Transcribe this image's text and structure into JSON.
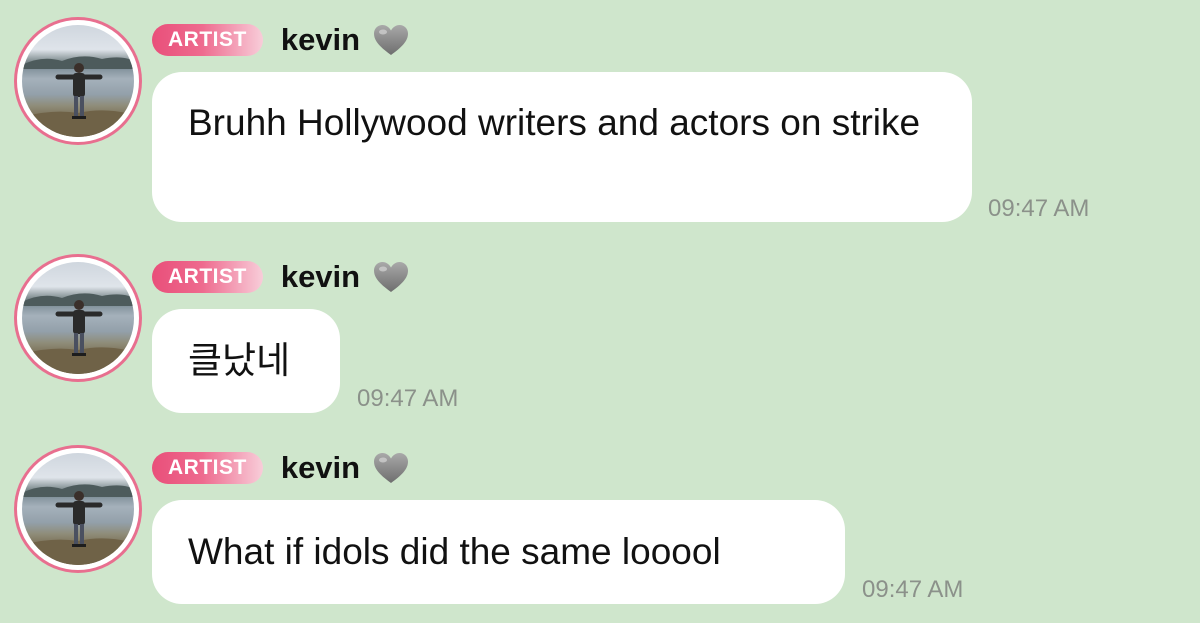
{
  "messages": [
    {
      "badge": "ARTIST",
      "author": "kevin",
      "text": "Bruhh Hollywood writers and actors on strike",
      "time": "09:47 AM"
    },
    {
      "badge": "ARTIST",
      "author": "kevin",
      "text": "클났네",
      "time": "09:47 AM"
    },
    {
      "badge": "ARTIST",
      "author": "kevin",
      "text": "What if idols did the same looool",
      "time": "09:47 AM"
    }
  ],
  "icons": {
    "heart": "grey-heart-icon",
    "avatar": "profile-photo"
  },
  "colors": {
    "background": "#cfe6cc",
    "badge_start": "#e94f7a",
    "badge_end": "#f8cdd9",
    "avatar_ring": "#e86f8f",
    "bubble": "#ffffff",
    "timestamp": "#8b918a",
    "heart": "#8c8c8c"
  }
}
